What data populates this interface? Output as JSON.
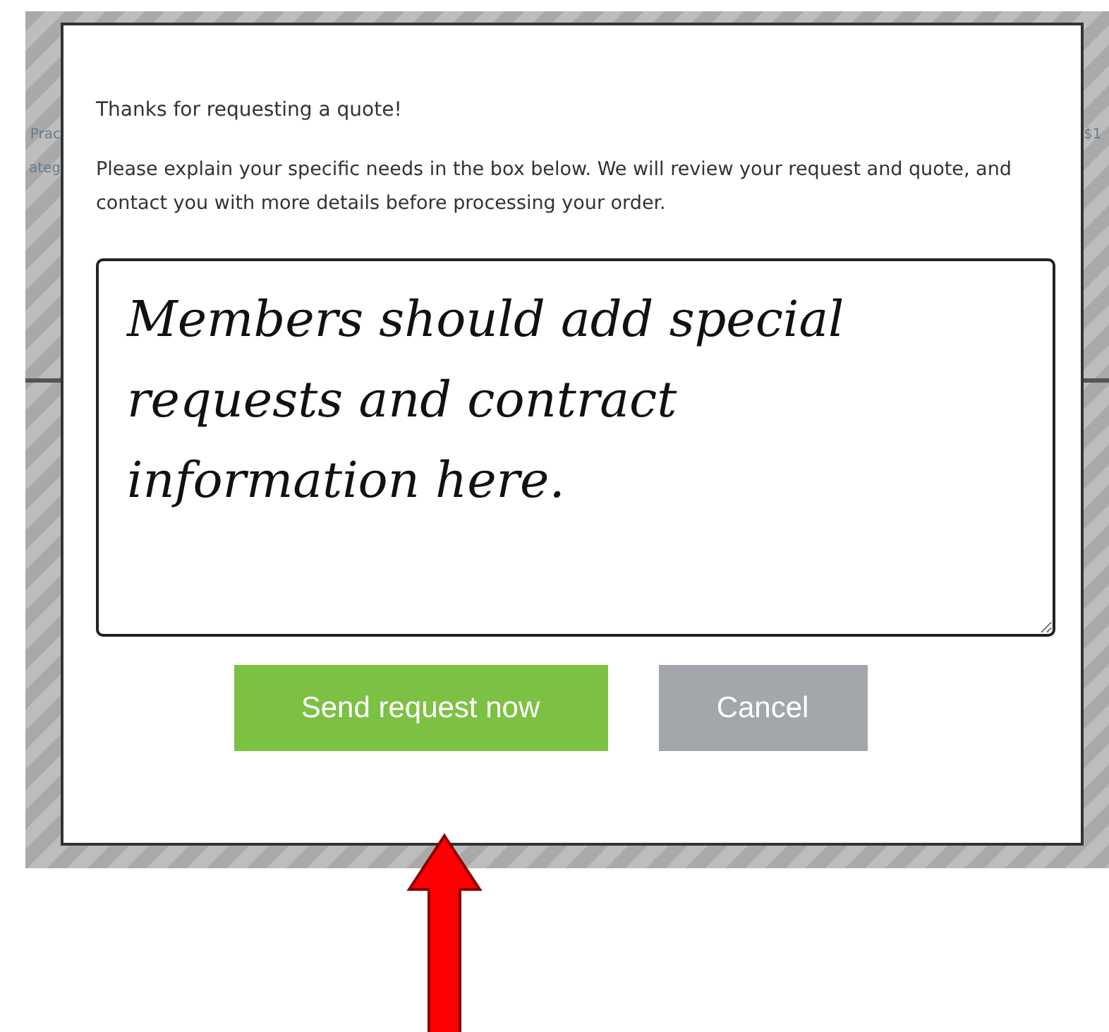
{
  "background": {
    "left_fragments": [
      "Prac",
      "ateg"
    ],
    "right_fragment": "$1"
  },
  "dialog": {
    "heading": "Thanks for requesting a quote!",
    "message": "Please explain your specific needs in the box below. We will review your request and quote, and contact you with more details before processing your order.",
    "request_field": {
      "value": "Members should add special requests and contract information here."
    },
    "buttons": [
      {
        "label": "Send request now",
        "kind": "primary"
      },
      {
        "label": "Cancel",
        "kind": "secondary"
      }
    ]
  },
  "annotation": {
    "kind": "arrow"
  }
}
